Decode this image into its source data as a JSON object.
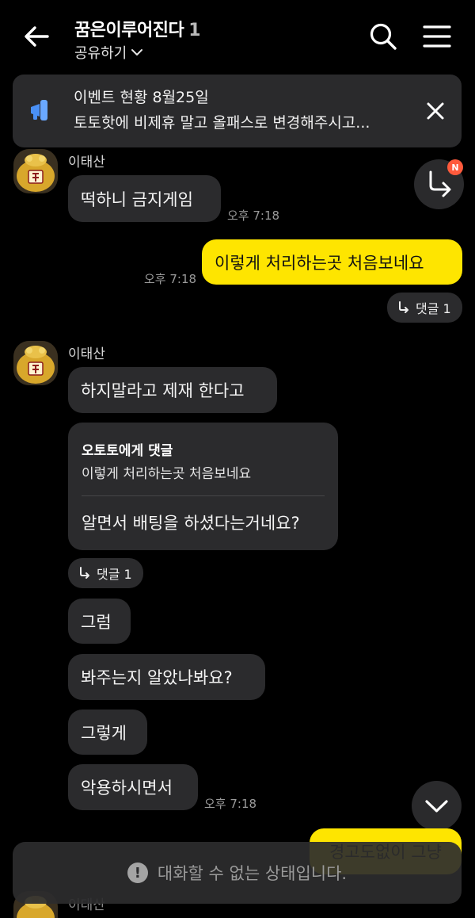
{
  "header": {
    "title": "꿈은이루어진다",
    "member_count": "1",
    "share_label": "공유하기"
  },
  "notice": {
    "title": "이벤트 현황 8월25일",
    "body": "토토핫에 비제휴 말고 올패스로 변경해주시고..."
  },
  "messages": {
    "m1": {
      "sender": "이태산",
      "text": "떡하니 금지게임",
      "time": "오후 7:18"
    },
    "m2": {
      "text": "이렇게 처리하는곳 처음보네요",
      "time": "오후 7:18"
    },
    "reply1": {
      "label": "댓글 1"
    },
    "m3": {
      "sender": "이태산",
      "text": "하지말라고 제재 한다고"
    },
    "quote": {
      "header": "오토토에게 댓글",
      "quoted": "이렇게 처리하는곳 처음보네요",
      "answer": "알면서 배팅을 하셨다는거네요?"
    },
    "reply2": {
      "label": "댓글 1"
    },
    "m4": {
      "text": "그럼"
    },
    "m5": {
      "text": "봐주는지 알았나봐요?"
    },
    "m6": {
      "text": "그렇게"
    },
    "m7": {
      "text": "악용하시면서",
      "time": "오후 7:18"
    },
    "m8": {
      "text": "경고도없이 그냥"
    },
    "m9": {
      "sender": "이태산"
    }
  },
  "badge": "N",
  "disabled_notice": "대화할 수 없는 상태입니다.",
  "colors": {
    "background": "#000000",
    "bubble_other": "#2b2b2d",
    "bubble_mine": "#fee500",
    "badge": "#ff5a3c"
  },
  "icons": {
    "back": "arrow-left-icon",
    "search": "search-icon",
    "menu": "hamburger-menu-icon",
    "notice": "megaphone-icon",
    "close": "close-icon",
    "reply": "reply-arrow-icon",
    "scroll_down": "chevron-down-icon",
    "warning": "exclamation-icon"
  }
}
